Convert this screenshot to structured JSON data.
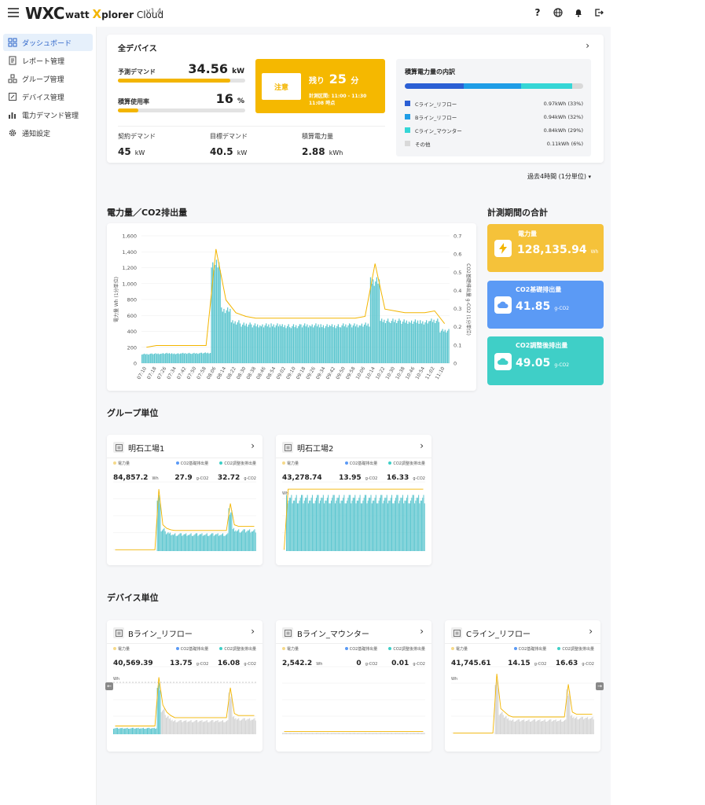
{
  "header": {
    "logo": "WXC",
    "brand_prefix": "watt",
    "brand_x": "X",
    "brand_suffix": "plorer",
    "brand_cloud": "Cloud",
    "version": "v1.4",
    "icons": [
      "help-icon",
      "globe-icon",
      "bell-icon",
      "logout-icon"
    ]
  },
  "sidebar": {
    "items": [
      {
        "label": "ダッシュボード",
        "icon": "dashboard-icon",
        "active": true
      },
      {
        "label": "レポート管理",
        "icon": "report-icon"
      },
      {
        "label": "グループ管理",
        "icon": "group-icon"
      },
      {
        "label": "デバイス管理",
        "icon": "device-icon"
      },
      {
        "label": "電力デマンド管理",
        "icon": "chart-icon"
      },
      {
        "label": "通知設定",
        "icon": "gear-icon"
      }
    ]
  },
  "summary": {
    "title": "全デバイス",
    "forecast_label": "予測デマンド",
    "forecast_value": "34.56",
    "forecast_unit": "kW",
    "forecast_progress": 0.88,
    "usage_label": "積算使用率",
    "usage_value": "16",
    "usage_unit": "%",
    "usage_progress": 0.16,
    "contract_label": "契約デマンド",
    "contract_value": "45",
    "contract_unit": "kW",
    "target_label": "目標デマンド",
    "target_value": "40.5",
    "target_unit": "kW",
    "energy_label": "積算電力量",
    "energy_value": "2.88",
    "energy_unit": "kWh",
    "alert_badge": "注意",
    "alert_remaining_prefix": "残り",
    "alert_remaining_value": "25",
    "alert_remaining_unit": "分",
    "alert_period_line1": "計測区間: 11:00 - 11:30",
    "alert_period_line2": "11:08 時点",
    "breakdown_title": "積算電力量の内訳",
    "breakdown": [
      {
        "name": "Cライン_リフロー",
        "value": "0.97kWh (33%)",
        "color": "#2b5fd4",
        "share": 33
      },
      {
        "name": "Bライン_リフロー",
        "value": "0.94kWh (32%)",
        "color": "#1f9de6",
        "share": 32
      },
      {
        "name": "Cライン_マウンター",
        "value": "0.84kWh (29%)",
        "color": "#35d6d6",
        "share": 29
      },
      {
        "name": "その他",
        "value": "0.11kWh (6%)",
        "color": "#d9d9d9",
        "share": 6
      }
    ]
  },
  "range_selector": "過去4時間 (1分単位)",
  "main_chart": {
    "section_title": "電力量／CO2排出量",
    "ylabel_left": "電力量 Wh (1分単位)",
    "ylabel_right": "CO2基礎排出量 g-CO2 (1分単位)"
  },
  "chart_data": {
    "type": "bar",
    "title": "電力量／CO2排出量",
    "ylabel": "電力量 Wh (1分単位)",
    "y2label": "CO2基礎排出量 g-CO2 (1分単位)",
    "ylim": [
      0,
      1600
    ],
    "y2lim": [
      0,
      0.7
    ],
    "yticks": [
      "0",
      "200",
      "400",
      "600",
      "800",
      "1,000",
      "1,200",
      "1,400",
      "1,600"
    ],
    "y2ticks": [
      "0",
      "0.1",
      "0.2",
      "0.3",
      "0.4",
      "0.5",
      "0.6",
      "0.7"
    ],
    "categories": [
      "07:10",
      "07:18",
      "07:26",
      "07:34",
      "07:42",
      "07:50",
      "07:58",
      "08:06",
      "08:14",
      "08:22",
      "08:30",
      "08:38",
      "08:46",
      "08:54",
      "09:02",
      "09:10",
      "09:18",
      "09:26",
      "09:34",
      "09:42",
      "09:50",
      "09:58",
      "10:06",
      "10:14",
      "10:22",
      "10:30",
      "10:38",
      "10:46",
      "10:54",
      "11:02",
      "11:10"
    ],
    "series": [
      {
        "type": "bar",
        "values": [
          120,
          125,
          130,
          125,
          130,
          130,
          135,
          1300,
          700,
          540,
          510,
          500,
          500,
          500,
          490,
          490,
          500,
          500,
          490,
          490,
          500,
          500,
          510,
          1080,
          560,
          560,
          550,
          550,
          540,
          560,
          430
        ]
      },
      {
        "type": "line",
        "values": [
          0.07,
          0.08,
          0.08,
          0.08,
          0.08,
          0.08,
          0.08,
          0.61,
          0.33,
          0.26,
          0.24,
          0.23,
          0.23,
          0.23,
          0.23,
          0.23,
          0.23,
          0.23,
          0.23,
          0.23,
          0.23,
          0.23,
          0.24,
          0.53,
          0.28,
          0.27,
          0.26,
          0.26,
          0.26,
          0.27,
          0.2
        ]
      }
    ]
  },
  "totals": {
    "section_title": "計測期間の合計",
    "power_label": "電力量",
    "power_value": "128,135.94",
    "power_unit": "Wh",
    "co2base_label": "CO2基礎排出量",
    "co2base_value": "41.85",
    "co2base_unit": "g-CO2",
    "co2adj_label": "CO2調整後排出量",
    "co2adj_value": "49.05",
    "co2adj_unit": "g-CO2"
  },
  "groups": {
    "section_title": "グループ単位",
    "metric_labels": [
      "電力量",
      "CO2基礎排出量",
      "CO2調整後排出量"
    ],
    "items": [
      {
        "name": "明石工場1",
        "power": "84,857.2",
        "power_unit": "Wh",
        "co2base": "27.9",
        "co2base_unit": "g-CO2",
        "co2adj": "32.72",
        "co2adj_unit": "g-CO2",
        "profile": [
          0,
          0,
          0,
          0,
          0,
          0,
          0,
          0,
          0,
          0,
          0,
          0.85,
          0.35,
          0.3,
          0.28,
          0.27,
          0.27,
          0.27,
          0.27,
          0.27,
          0.27,
          0.27,
          0.27,
          0.27,
          0.27,
          0.27,
          0.27,
          0.27,
          0.27,
          0.65,
          0.35,
          0.33,
          0.33,
          0.33,
          0.33,
          0.33
        ]
      },
      {
        "name": "明石工場2",
        "power": "43,278.74",
        "power_unit": "Wh",
        "co2base": "13.95",
        "co2base_unit": "g-CO2",
        "co2adj": "16.33",
        "co2adj_unit": "g-CO2",
        "profile": [
          0,
          0.85,
          0.85,
          0.85,
          0.85,
          0.85,
          0.85,
          0.85,
          0.85,
          0.85,
          0.85,
          0.85,
          0.85,
          0.85,
          0.85,
          0.85,
          0.85,
          0.85,
          0.85,
          0.85,
          0.85,
          0.85,
          0.85,
          0.85,
          0.85,
          0.85,
          0.85,
          0.85,
          0.85,
          0.85,
          0.85,
          0.85,
          0.85,
          0.85,
          0.85,
          0.85
        ]
      }
    ]
  },
  "devices": {
    "section_title": "デバイス単位",
    "metric_labels": [
      "電力量",
      "CO2基礎排出量",
      "CO2調整後排出量"
    ],
    "items": [
      {
        "name": "Bライン_リフロー",
        "power": "40,569.39",
        "power_unit": "Wh",
        "co2base": "13.75",
        "co2base_unit": "g-CO2",
        "co2adj": "16.08",
        "co2adj_unit": "g-CO2",
        "profile": [
          0.1,
          0.1,
          0.1,
          0.1,
          0.1,
          0.1,
          0.1,
          0.1,
          0.1,
          0.1,
          0.1,
          0.8,
          0.4,
          0.3,
          0.25,
          0.22,
          0.22,
          0.22,
          0.22,
          0.22,
          0.22,
          0.22,
          0.22,
          0.22,
          0.22,
          0.22,
          0.22,
          0.22,
          0.22,
          0.65,
          0.28,
          0.25,
          0.25,
          0.25,
          0.25,
          0.25
        ],
        "teal_to": 12
      },
      {
        "name": "Bライン_マウンター",
        "power": "2,542.2",
        "power_unit": "Wh",
        "co2base": "0",
        "co2base_unit": "g-CO2",
        "co2adj": "0.01",
        "co2adj_unit": "g-CO2",
        "profile": [
          0.02,
          0.02,
          0.02,
          0.02,
          0.02,
          0.02,
          0.02,
          0.02,
          0.02,
          0.02,
          0.02,
          0.02,
          0.02,
          0.02,
          0.02,
          0.02,
          0.02,
          0.02,
          0.02,
          0.02,
          0.02,
          0.02,
          0.02,
          0.02,
          0.02,
          0.02,
          0.02,
          0.02,
          0.02,
          0.02,
          0.02,
          0.02,
          0.02,
          0.02,
          0.02,
          0.02
        ],
        "teal_to": 0
      },
      {
        "name": "Cライン_リフロー",
        "power": "41,745.61",
        "power_unit": "Wh",
        "co2base": "14.15",
        "co2base_unit": "g-CO2",
        "co2adj": "16.63",
        "co2adj_unit": "g-CO2",
        "profile": [
          0,
          0,
          0,
          0,
          0,
          0,
          0,
          0,
          0,
          0,
          0,
          0.85,
          0.35,
          0.3,
          0.25,
          0.23,
          0.23,
          0.23,
          0.23,
          0.23,
          0.23,
          0.23,
          0.23,
          0.23,
          0.23,
          0.23,
          0.23,
          0.23,
          0.23,
          0.7,
          0.3,
          0.27,
          0.27,
          0.27,
          0.27,
          0.27
        ],
        "teal_to": 0
      }
    ]
  },
  "colors": {
    "accent": "#2b63c8",
    "yellow": "#f3b500",
    "teal": "#3cc9c9",
    "blue": "#5b9af5",
    "tealtile": "#3fcfc7"
  }
}
